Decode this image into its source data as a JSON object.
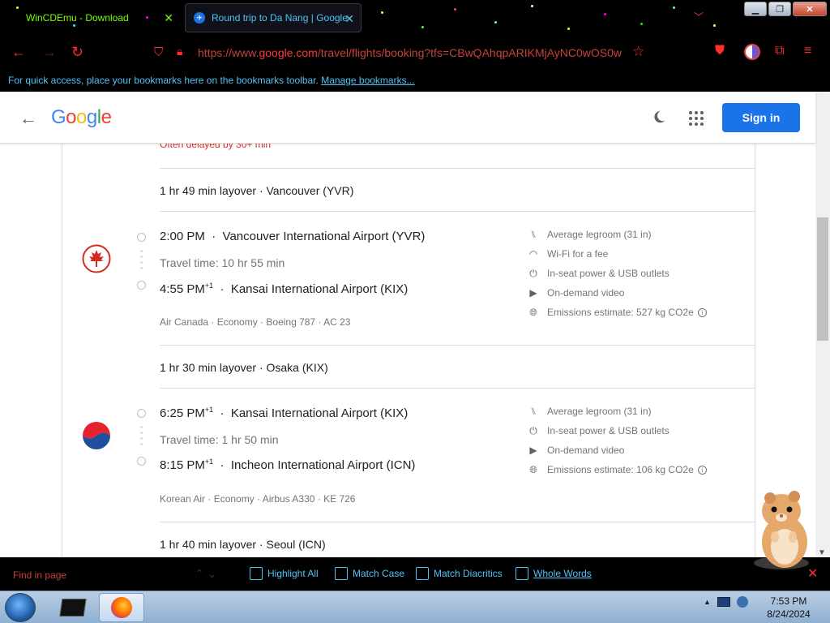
{
  "browser": {
    "tabs": [
      {
        "title": "WinCDEmu - Download",
        "active": false
      },
      {
        "title": "Round trip to Da Nang | Google",
        "active": true
      }
    ],
    "url": {
      "prefix": "https://www.",
      "domain": "google.com",
      "path": "/travel/flights/booking?tfs=CBwQAhqpARIKMjAyNC0wOS0w"
    },
    "bookmarks_bar": {
      "text": "For quick access, place your bookmarks here on the bookmarks toolbar.",
      "link": "Manage bookmarks..."
    }
  },
  "header": {
    "logo": "Google",
    "signin_label": "Sign in"
  },
  "itinerary": {
    "delay_note": "Often delayed by 30+ min",
    "layover_1": "1 hr 49 min layover · Vancouver (YVR)",
    "segment_1": {
      "depart_time": "2:00 PM",
      "depart_airport": "Vancouver International Airport (YVR)",
      "travel_time": "Travel time: 10 hr 55 min",
      "arrive_time": "4:55 PM",
      "arrive_plus": "+1",
      "arrive_airport": "Kansai International Airport (KIX)",
      "meta": "Air Canada · Economy · Boeing 787 · AC 23",
      "amenities": [
        {
          "icon": "legroom-icon",
          "text": "Average legroom (31 in)"
        },
        {
          "icon": "wifi-icon",
          "text": "Wi-Fi for a fee"
        },
        {
          "icon": "power-icon",
          "text": "In-seat power & USB outlets"
        },
        {
          "icon": "video-icon",
          "text": "On-demand video"
        },
        {
          "icon": "globe-icon",
          "text": "Emissions estimate: 527 kg CO2e"
        }
      ]
    },
    "layover_2": "1 hr 30 min layover · Osaka (KIX)",
    "segment_2": {
      "depart_time": "6:25 PM",
      "depart_plus": "+1",
      "depart_airport": "Kansai International Airport (KIX)",
      "travel_time": "Travel time: 1 hr 50 min",
      "arrive_time": "8:15 PM",
      "arrive_plus": "+1",
      "arrive_airport": "Incheon International Airport (ICN)",
      "meta": "Korean Air · Economy · Airbus A330 · KE 726",
      "amenities": [
        {
          "icon": "legroom-icon",
          "text": "Average legroom (31 in)"
        },
        {
          "icon": "power-icon",
          "text": "In-seat power & USB outlets"
        },
        {
          "icon": "video-icon",
          "text": "On-demand video"
        },
        {
          "icon": "globe-icon",
          "text": "Emissions estimate: 106 kg CO2e"
        }
      ]
    },
    "layover_3": "1 hr 40 min layover · Seoul (ICN)"
  },
  "findbar": {
    "placeholder": "Find in page",
    "options": [
      "Highlight All",
      "Match Case",
      "Match Diacritics",
      "Whole Words"
    ]
  },
  "taskbar": {
    "time": "7:53 PM",
    "date": "8/24/2024"
  },
  "colors": {
    "accent": "#1a73e8",
    "theme_red": "#ff2d2d",
    "theme_blue": "#4fc3f7"
  }
}
